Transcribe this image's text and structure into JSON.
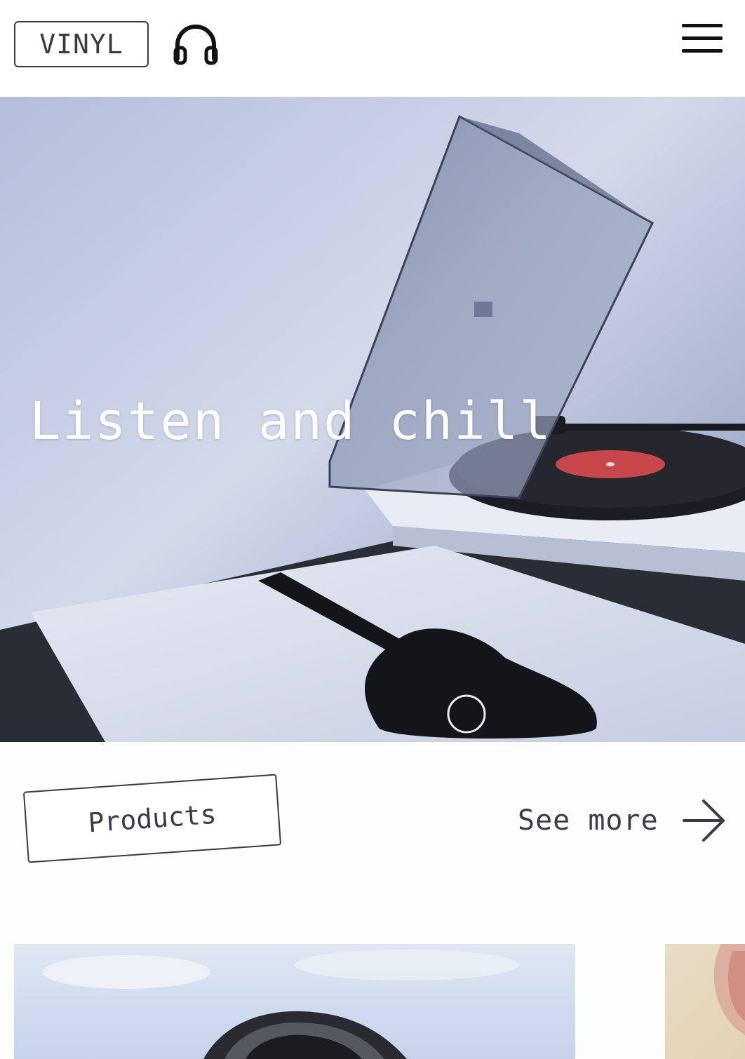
{
  "header": {
    "logo_text": "VINYL",
    "headphones_icon": "headphones-icon",
    "menu_icon": "hamburger-menu-icon"
  },
  "hero": {
    "title": "Listen and chill",
    "image": "turntable-with-guitar-record-sleeve"
  },
  "products_section": {
    "tag_label": "Products",
    "see_more_label": "See more",
    "arrow_icon": "arrow-right-icon"
  },
  "products": [
    {
      "image": "vinyl-record-photo-blue-sky"
    },
    {
      "image": "record-sleeve-beige"
    }
  ],
  "colors": {
    "text_dark": "#3a3a48",
    "hero_text": "#ffffff",
    "hero_tint": "#b7c0dc"
  }
}
